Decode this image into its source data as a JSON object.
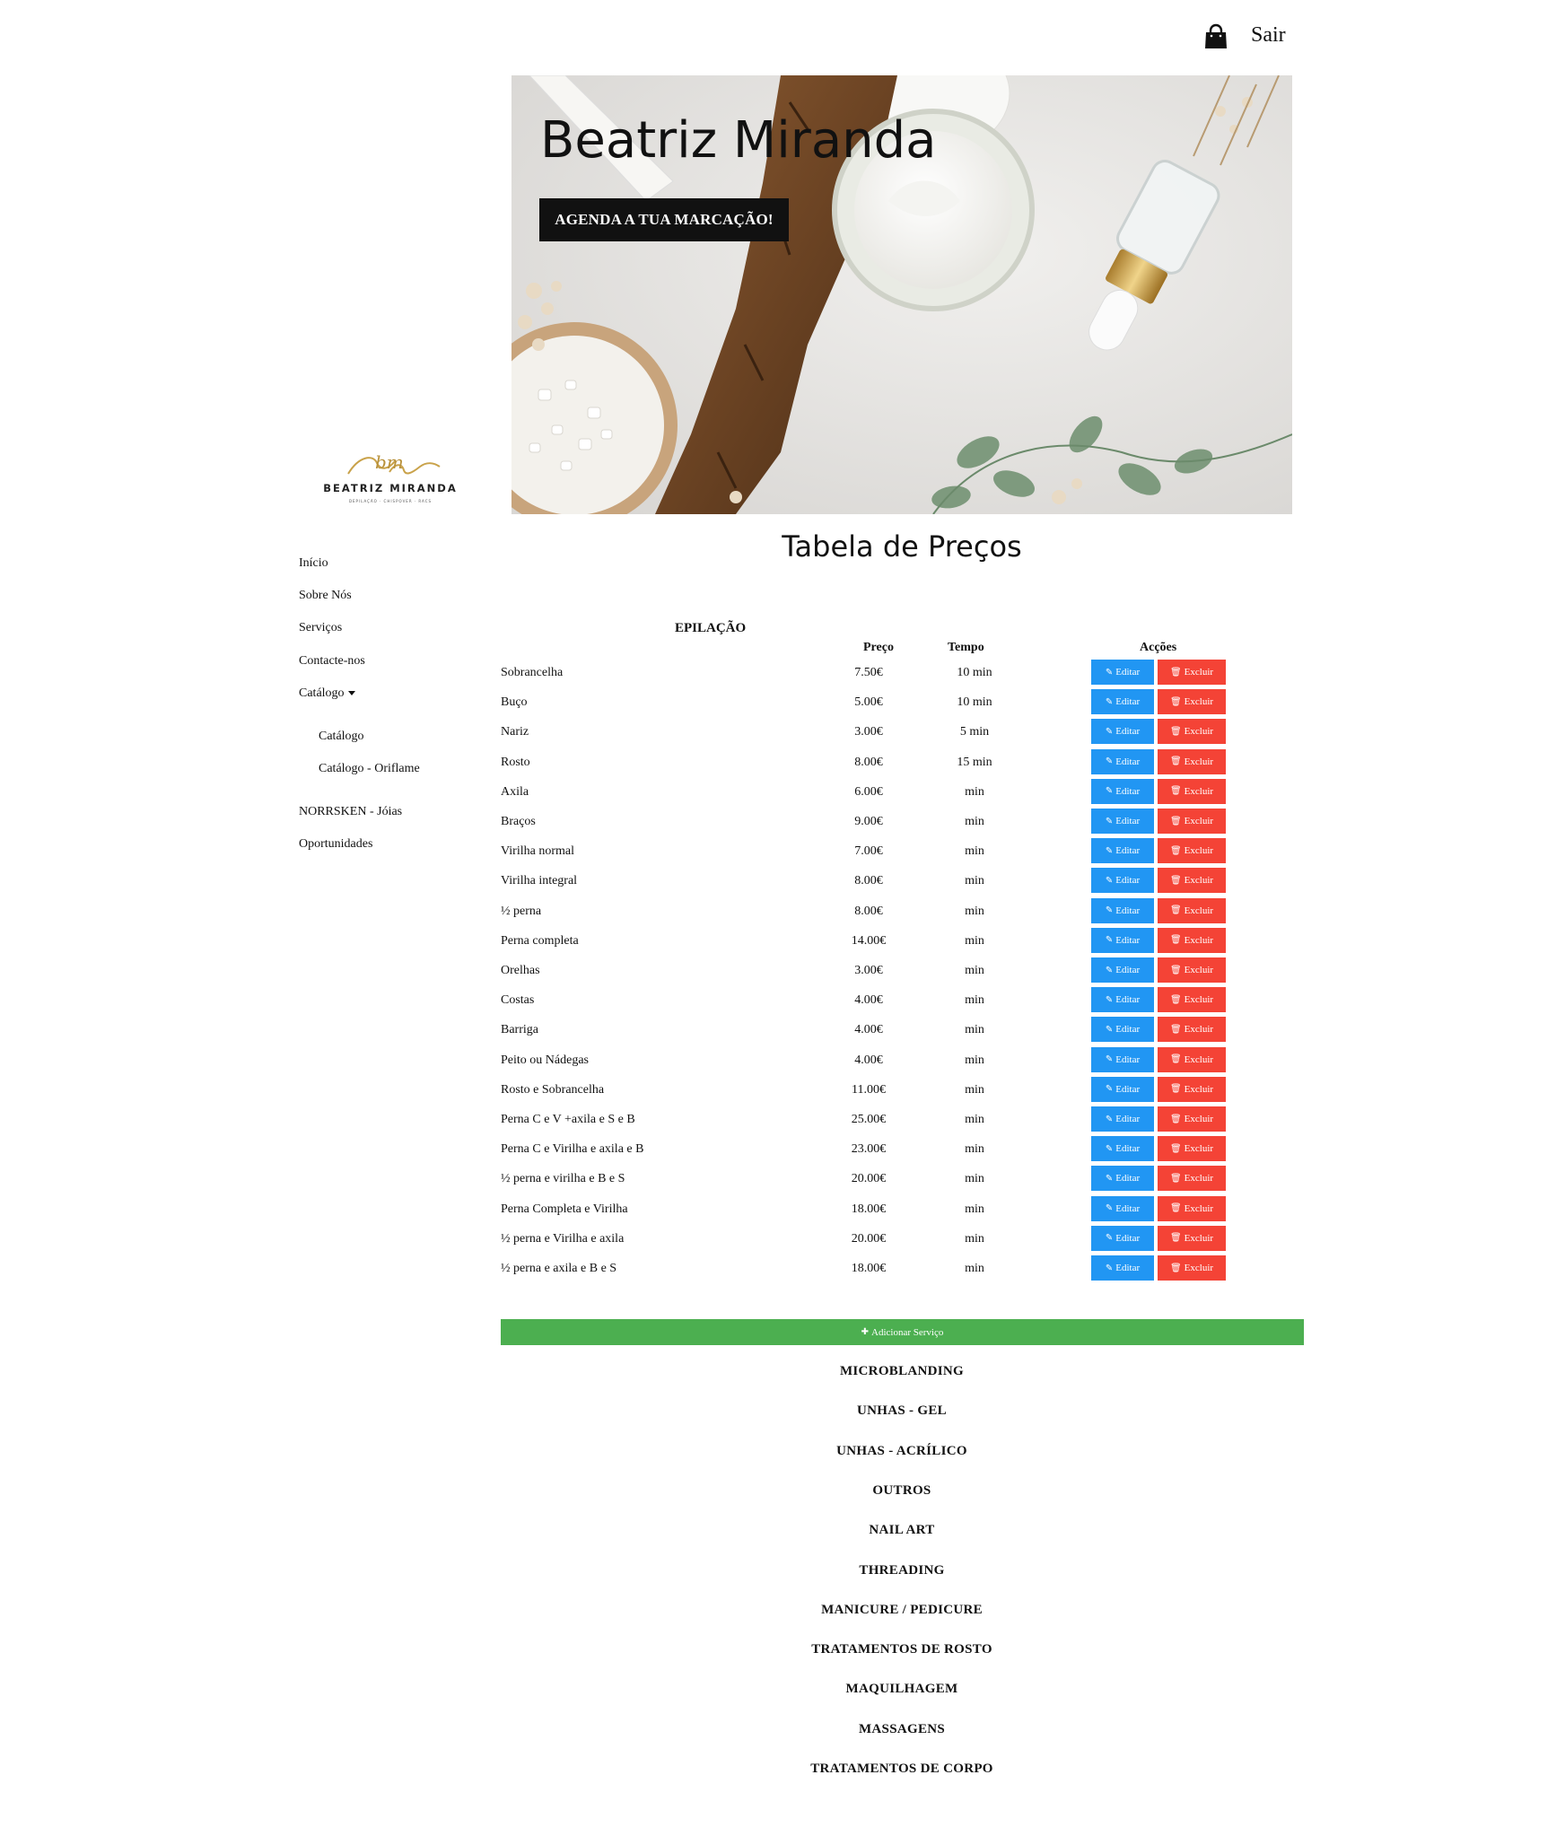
{
  "header": {
    "logout_label": "Sair"
  },
  "logo": {
    "monogram": "bm",
    "name": "BEATRIZ MIRANDA",
    "tagline": "DEPILAÇÃO · CHISPOVER · RACS"
  },
  "sidebar": {
    "items": [
      {
        "label": "Início"
      },
      {
        "label": "Sobre Nós"
      },
      {
        "label": "Serviços"
      },
      {
        "label": "Contacte-nos"
      },
      {
        "label": "Catálogo"
      },
      {
        "label": "Catálogo"
      },
      {
        "label": "Catálogo - Oriflame"
      },
      {
        "label": "NORRSKEN - Jóias"
      },
      {
        "label": "Oportunidades"
      }
    ]
  },
  "hero": {
    "title": "Beatriz Miranda",
    "cta": "AGENDA A TUA MARCAÇÃO!"
  },
  "page_title": "Tabela de Preços",
  "table": {
    "category": "EPILAÇÃO",
    "headers": {
      "price": "Preço",
      "time": "Tempo",
      "actions": "Acções"
    },
    "edit_label": "Editar",
    "delete_label": "Excluir",
    "rows": [
      {
        "name": "Sobrancelha",
        "price": "7.50€",
        "time": "10 min"
      },
      {
        "name": "Buço",
        "price": "5.00€",
        "time": "10 min"
      },
      {
        "name": "Nariz",
        "price": "3.00€",
        "time": "5 min"
      },
      {
        "name": "Rosto",
        "price": "8.00€",
        "time": "15 min"
      },
      {
        "name": "Axila",
        "price": "6.00€",
        "time": "min"
      },
      {
        "name": "Braços",
        "price": "9.00€",
        "time": "min"
      },
      {
        "name": "Virilha normal",
        "price": "7.00€",
        "time": "min"
      },
      {
        "name": "Virilha integral",
        "price": "8.00€",
        "time": "min"
      },
      {
        "name": "½ perna",
        "price": "8.00€",
        "time": "min"
      },
      {
        "name": "Perna completa",
        "price": "14.00€",
        "time": "min"
      },
      {
        "name": "Orelhas",
        "price": "3.00€",
        "time": "min"
      },
      {
        "name": "Costas",
        "price": "4.00€",
        "time": "min"
      },
      {
        "name": "Barriga",
        "price": "4.00€",
        "time": "min"
      },
      {
        "name": "Peito ou Nádegas",
        "price": "4.00€",
        "time": "min"
      },
      {
        "name": "Rosto e Sobrancelha",
        "price": "11.00€",
        "time": "min"
      },
      {
        "name": "Perna C e V +axila e S e B",
        "price": "25.00€",
        "time": "min"
      },
      {
        "name": "Perna C e Virilha e axila e B",
        "price": "23.00€",
        "time": "min"
      },
      {
        "name": "½ perna e virilha e B e S",
        "price": "20.00€",
        "time": "min"
      },
      {
        "name": "Perna Completa e Virilha",
        "price": "18.00€",
        "time": "min"
      },
      {
        "name": "½ perna e Virilha e axila",
        "price": "20.00€",
        "time": "min"
      },
      {
        "name": "½ perna e axila e B e S",
        "price": "18.00€",
        "time": "min"
      }
    ],
    "add_label": "Adicionar Serviço"
  },
  "sections": [
    "MICROBLANDING",
    "UNHAS - GEL",
    "UNHAS - ACRÍLICO",
    "OUTROS",
    "NAIL ART",
    "THREADING",
    "MANICURE / PEDICURE",
    "TRATAMENTOS DE ROSTO",
    "MAQUILHAGEM",
    "MASSAGENS",
    "TRATAMENTOS DE CORPO"
  ],
  "colors": {
    "edit": "#2196f3",
    "delete": "#f44336",
    "add": "#4caf50",
    "cta_bg": "#111111"
  }
}
